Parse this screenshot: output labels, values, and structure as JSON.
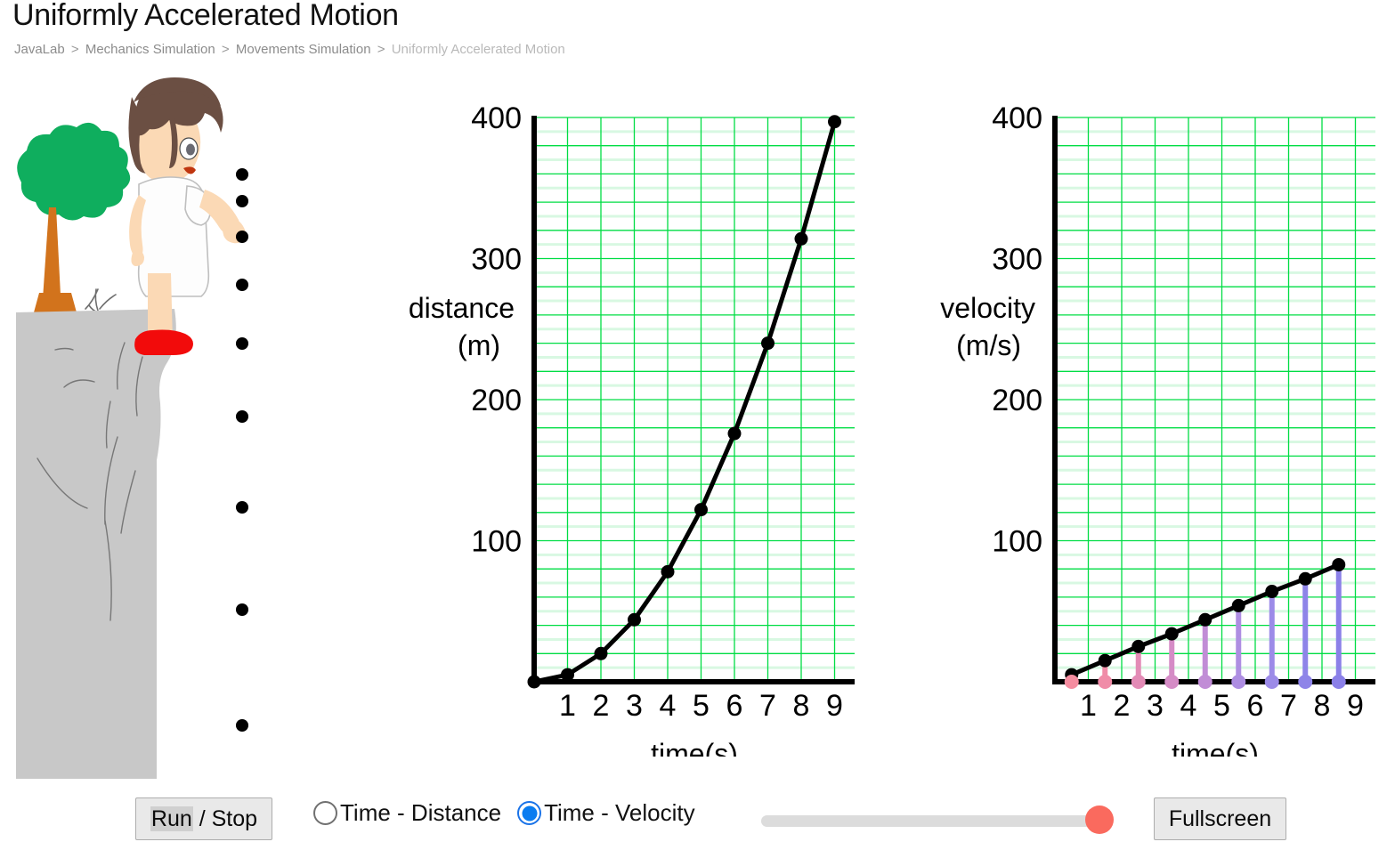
{
  "header": {
    "title": "Uniformly Accelerated Motion",
    "breadcrumb": [
      "JavaLab",
      "Mechanics Simulation",
      "Movements Simulation",
      "Uniformly Accelerated Motion"
    ],
    "breadcrumb_separator": ">"
  },
  "scene": {
    "description": "Girl standing on a cliff dropping balls that accelerate downward next to a tree",
    "colors": {
      "tree_foliage": "#0FAE5E",
      "tree_trunk": "#D2731C",
      "cliff": "#C8C8C8",
      "cliff_crack": "#777777",
      "hair": "#6B4F43",
      "skin": "#FBD9B5",
      "dress": "#FDFDFD",
      "dress_outline": "#BFBFBF",
      "shoe": "#F20B0B",
      "ball": "#000000",
      "mouth": "#C0360F",
      "grass": "#6F6F6F"
    },
    "ball_y_positions": [
      196,
      226,
      266,
      320,
      386,
      468,
      570,
      685,
      815
    ],
    "ball_x": 272,
    "ball_radius": 7
  },
  "chart_data": [
    {
      "id": "distance-graph",
      "type": "line",
      "title": "",
      "xlabel": "time(s)",
      "ylabel": "distance\n(m)",
      "ylabel_line1": "distance",
      "ylabel_line2": "(m)",
      "x": [
        0,
        1,
        2,
        3,
        4,
        5,
        6,
        7,
        8,
        9
      ],
      "values": [
        0,
        5,
        20,
        44,
        78,
        122,
        176,
        240,
        314,
        397
      ],
      "xlim": [
        0,
        9.6
      ],
      "ylim": [
        0,
        400
      ],
      "xticks": [
        1,
        2,
        3,
        4,
        5,
        6,
        7,
        8,
        9
      ],
      "xtick_labels": [
        "1",
        "2",
        "3",
        "4",
        "5",
        "6",
        "7",
        "8",
        "9"
      ],
      "yticks": [
        100,
        200,
        300,
        400
      ],
      "ytick_labels": [
        "100",
        "200",
        "300",
        "400"
      ],
      "grid": true,
      "grid_major_step": 20,
      "grid_color": "#00DD44",
      "grid_minor_color": "#D8F8E2",
      "line_color": "#000000",
      "marker_color": "#000000",
      "legend": "none"
    },
    {
      "id": "velocity-graph",
      "type": "line",
      "title": "",
      "xlabel": "time(s)",
      "ylabel": "velocity\n(m/s)",
      "ylabel_line1": "velocity",
      "ylabel_line2": "(m/s)",
      "x": [
        0.5,
        1.5,
        2.5,
        3.5,
        4.5,
        5.5,
        6.5,
        7.5,
        8.5
      ],
      "values": [
        5,
        15,
        25,
        34,
        44,
        54,
        64,
        73,
        83
      ],
      "xlim": [
        0,
        9.6
      ],
      "ylim": [
        0,
        400
      ],
      "xticks": [
        1,
        2,
        3,
        4,
        5,
        6,
        7,
        8,
        9
      ],
      "xtick_labels": [
        "1",
        "2",
        "3",
        "4",
        "5",
        "6",
        "7",
        "8",
        "9"
      ],
      "yticks": [
        100,
        200,
        300,
        400
      ],
      "ytick_labels": [
        "100",
        "200",
        "300",
        "400"
      ],
      "grid": true,
      "grid_major_step": 20,
      "grid_color": "#00DD44",
      "grid_minor_color": "#D8F8E2",
      "line_color": "#000000",
      "marker_color": "#000000",
      "legend": "none",
      "drop_line_colors": [
        "#F58DA0",
        "#F08CA8",
        "#E38BB6",
        "#D58CC6",
        "#C18DD6",
        "#AE8EE2",
        "#9C8BE8",
        "#8E84E8",
        "#8B80E8"
      ]
    }
  ],
  "controls": {
    "run_stop_label_highlight": "Run",
    "run_stop_label_rest": " / Stop",
    "fullscreen_label": "Fullscreen",
    "radios": [
      {
        "label": "Time - Distance",
        "checked": false
      },
      {
        "label": "Time - Velocity",
        "checked": true
      }
    ],
    "slider": {
      "value": 100,
      "min": 0,
      "max": 100
    },
    "colors": {
      "radio_checked": "#0A7CF0",
      "slider_thumb": "#FA6A5E",
      "slider_track": "#DCDCDC"
    }
  }
}
